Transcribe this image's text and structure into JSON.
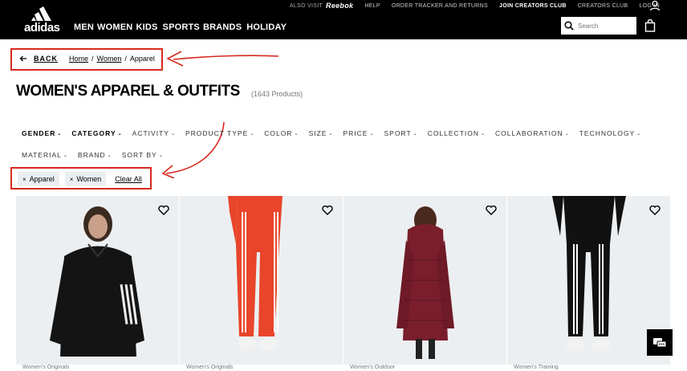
{
  "header": {
    "logo_text": "adidas",
    "nav": [
      "MEN",
      "WOMEN",
      "KIDS",
      "SPORTS",
      "BRANDS",
      "HOLIDAY"
    ],
    "also_visit": "ALSO VISIT",
    "reebok": "Reebok",
    "top_links": [
      "HELP",
      "ORDER TRACKER AND RETURNS",
      "JOIN CREATORS CLUB",
      "CREATORS CLUB",
      "LOG IN"
    ],
    "search_placeholder": "Search"
  },
  "breadcrumb": {
    "back": "BACK",
    "items": [
      "Home",
      "Women",
      "Apparel"
    ]
  },
  "title": "WOMEN'S APPAREL & OUTFITS",
  "product_count": "(1643 Products)",
  "filters_row1": [
    "GENDER",
    "CATEGORY",
    "ACTIVITY",
    "PRODUCT TYPE",
    "COLOR",
    "SIZE",
    "PRICE",
    "SPORT",
    "COLLECTION",
    "COLLABORATION",
    "TECHNOLOGY"
  ],
  "filters_row2": [
    "MATERIAL",
    "BRAND",
    "SORT BY"
  ],
  "chips": [
    "Apparel",
    "Women"
  ],
  "clear_all": "Clear All",
  "products": [
    {
      "category": "Women's Originals",
      "color": "#111111"
    },
    {
      "category": "Women's Originals",
      "color": "#e8452a"
    },
    {
      "category": "Women's Outdoor",
      "color": "#7a1e2c"
    },
    {
      "category": "Women's Training",
      "color": "#111111"
    }
  ],
  "accent_color": "#d62a1e"
}
